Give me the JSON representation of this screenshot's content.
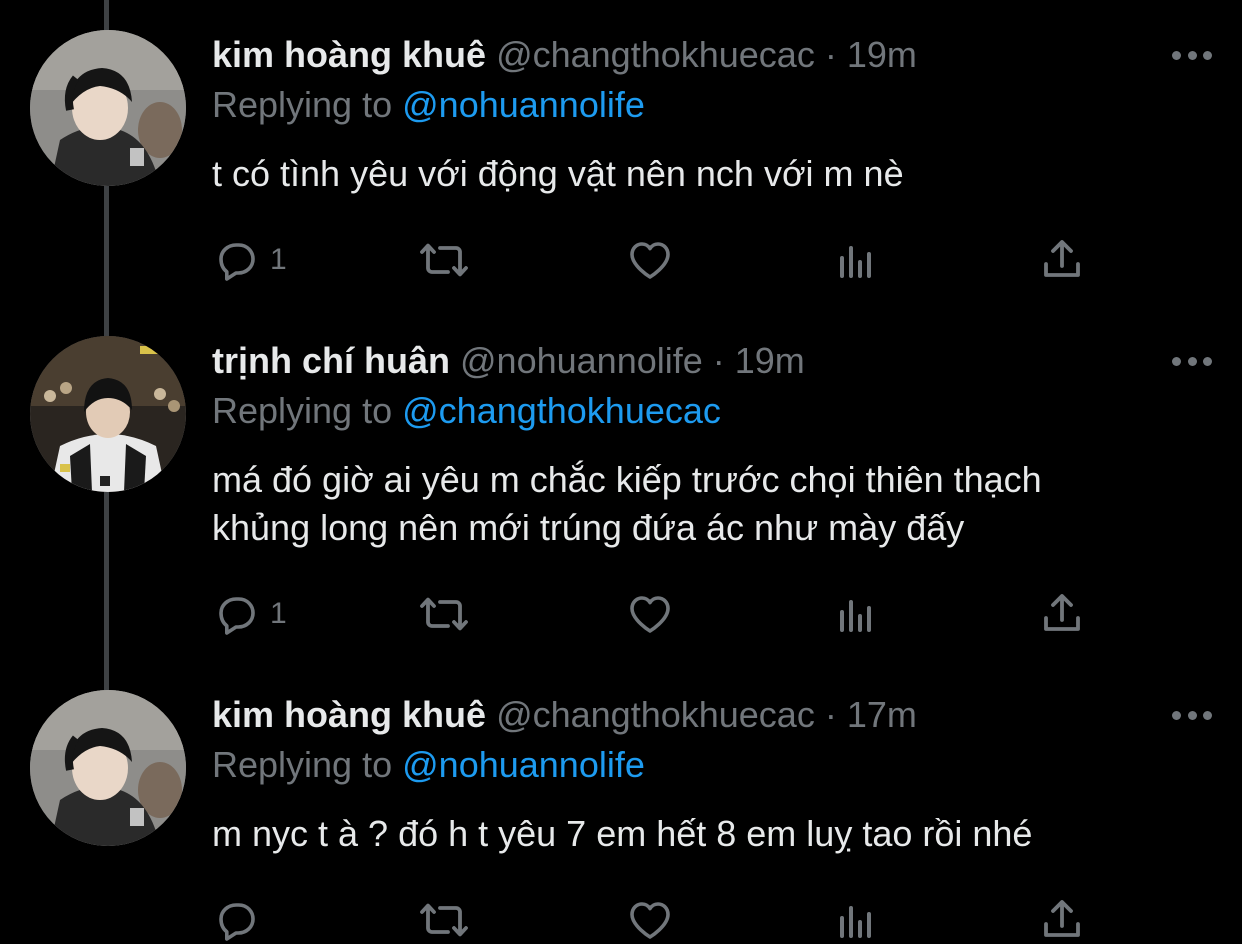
{
  "tweets": [
    {
      "name": "kim hoàng khuê",
      "handle": "@changthokhuecac",
      "separator": "·",
      "time": "19m",
      "replying_prefix": "Replying to",
      "replying_to": "@nohuannolife",
      "text": "t có tình yêu với động vật nên nch với m nè",
      "reply_count": "1"
    },
    {
      "name": "trịnh chí huân",
      "handle": "@nohuannolife",
      "separator": "·",
      "time": "19m",
      "replying_prefix": "Replying to",
      "replying_to": "@changthokhuecac",
      "text_lines": [
        "má đó giờ ai yêu m chắc kiếp trước chọi thiên thạch",
        "khủng long nên mới trúng đứa ác như mày đấy"
      ],
      "reply_count": "1"
    },
    {
      "name": "kim hoàng khuê",
      "handle": "@changthokhuecac",
      "separator": "·",
      "time": "17m",
      "replying_prefix": "Replying to",
      "replying_to": "@nohuannolife",
      "text": "m nyc t à ? đó h t yêu 7 em hết 8 em luỵ tao rồi nhé",
      "reply_count": ""
    }
  ],
  "icons": {
    "reply": "reply-icon",
    "retweet": "retweet-icon",
    "like": "like-heart-icon",
    "views": "analytics-icon",
    "share": "share-icon",
    "more": "more-options-icon"
  },
  "colors": {
    "background": "#000000",
    "text": "#e7e9ea",
    "secondary": "#71767b",
    "link": "#1d9bf0",
    "thread_line": "#3e4144"
  }
}
